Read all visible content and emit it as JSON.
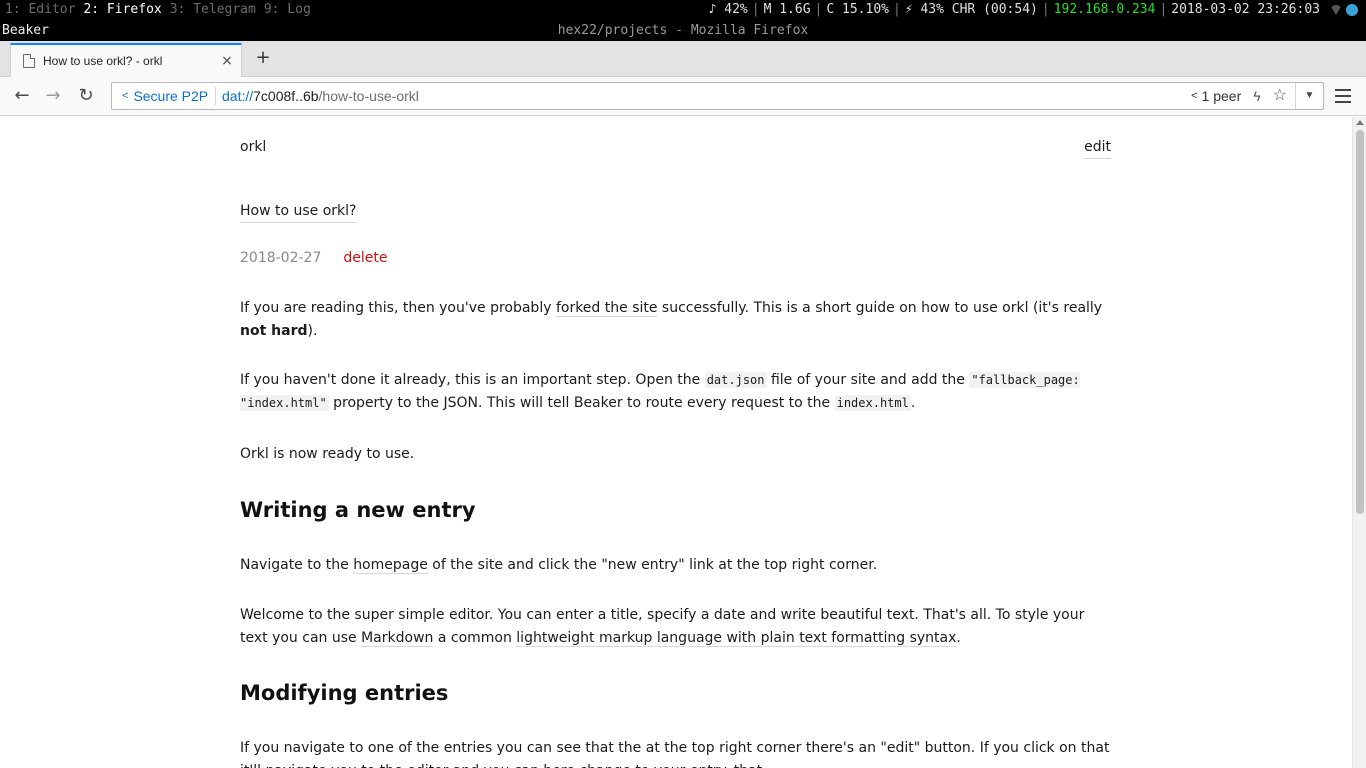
{
  "i3bar": {
    "workspaces": [
      {
        "label": "1: Editor",
        "active": false
      },
      {
        "label": "2: Firefox",
        "active": true
      },
      {
        "label": "3: Telegram",
        "active": false
      },
      {
        "label": "9: Log",
        "active": false
      }
    ],
    "volume": "♪ 42%",
    "memory": "M 1.6G",
    "cpu": "C 15.10%",
    "battery": "⚡ 43% CHR (00:54)",
    "ip": "192.168.0.234",
    "datetime": "2018-03-02 23:26:03",
    "ip_color": "#27e027"
  },
  "window": {
    "app_name": "Beaker",
    "title": "hex22/projects - Mozilla Firefox"
  },
  "tabs": [
    {
      "label": "How to use orkl? - orkl",
      "active": true
    }
  ],
  "newtab_glyph": "+",
  "toolbar": {
    "back_glyph": "←",
    "forward_glyph": "→",
    "reload_glyph": "↻",
    "identity_label": "Secure P2P",
    "url_scheme": "dat://",
    "url_host": "7c008f..6b",
    "url_path": "/how-to-use-orkl",
    "peers_label": "1 peer",
    "bolt_glyph": "ϟ",
    "star_glyph": "☆",
    "dropdown_glyph": "▼",
    "accent": "#0a6fd1"
  },
  "page": {
    "site_name": "orkl",
    "edit_label": "edit",
    "post_title": "How to use orkl?",
    "date": "2018-02-27",
    "delete_label": "delete",
    "p1": {
      "t1": "If you are reading this, then you've probably ",
      "link": "forked the site",
      "t2": " successfully. This is a short guide on how to use orkl (it's really ",
      "bold": "not hard",
      "t3": ")."
    },
    "p2": {
      "t1": "If you haven't done it already, this is an important step. Open the ",
      "code1": "dat.json",
      "t2": " file of your site and add the ",
      "code2": "\"fallback_page: \"index.html\"",
      "t3": " property to the JSON. This will tell Beaker to route every request to the ",
      "code3": "index.html",
      "t4": "."
    },
    "p3": "Orkl is now ready to use.",
    "h1": "Writing a new entry",
    "p4": {
      "t1": "Navigate to the ",
      "link": "homepage",
      "t2": " of the site and click the \"new entry\" link at the top right corner."
    },
    "p5": {
      "t1": "Welcome to the super simple editor. You can enter a title, specify a date and write beautiful text. That's all. To style your text you can use ",
      "link1": "Markdown",
      "t2": " a common ",
      "link2": "lightweight markup language with plain text formatting syntax",
      "t3": "."
    },
    "h2": "Modifying entries",
    "p6": "If you navigate to one of the entries you can see that the at the top right corner there's an \"edit\" button. If you click on that it'll navigate you to the editor and you can here change to your entry. that.",
    "delete_color": "#d10f0f"
  }
}
